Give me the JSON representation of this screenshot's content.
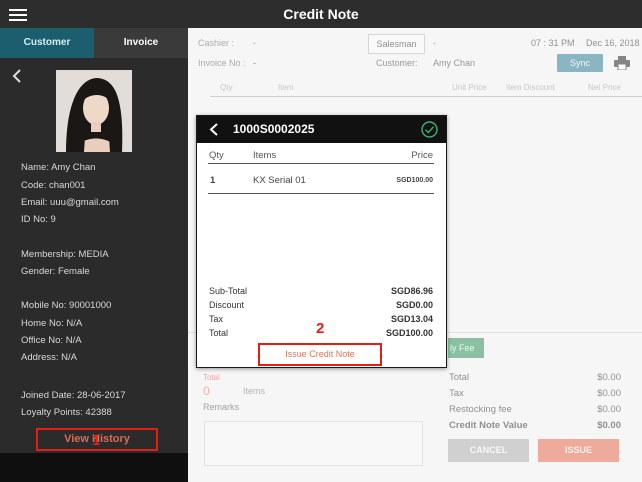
{
  "header": {
    "title": "Credit Note",
    "menu_icon": "hamburger-icon"
  },
  "sidebar": {
    "tabs": [
      {
        "label": "Customer",
        "active": true
      },
      {
        "label": "Invoice",
        "active": false
      }
    ],
    "customer": {
      "name": "Name: Amy Chan",
      "code": "Code: chan001",
      "email": "Email: uuu@gmail.com",
      "id_no": "ID No: 9",
      "membership": "Membership: MEDIA",
      "gender": "Gender: Female",
      "mobile": "Mobile No: 90001000",
      "home": "Home No: N/A",
      "office": "Office No: N/A",
      "address": "Address: N/A",
      "joined": "Joined Date: 28-06-2017",
      "loyalty": "Loyalty Points: 42388"
    },
    "view_history_label": "View History"
  },
  "annotations": {
    "one": "1",
    "two": "2"
  },
  "main": {
    "cashier_label": "Cashier :",
    "cashier_value": "-",
    "invoice_label": "Invoice No :",
    "invoice_value": "-",
    "salesman_label": "Salesman",
    "salesman_value": "-",
    "time": "07 : 31 PM",
    "date": "Dec 16, 2018",
    "customer_label": "Customer:",
    "customer_value": "Amy Chan",
    "sync_label": "Sync",
    "columns": [
      "Qty",
      "Item",
      "Unit Price",
      "Item Discount",
      "Net Price"
    ],
    "fee_chip": "ly Fee",
    "total_label": "Total",
    "total_items": "0",
    "items_label": "Items",
    "remarks_label": "Remarks",
    "summary": [
      {
        "label": "Total",
        "value": "$0.00"
      },
      {
        "label": "Tax",
        "value": "$0.00"
      },
      {
        "label": "Restocking fee",
        "value": "$0.00"
      },
      {
        "label": "Credit Note Value",
        "value": "$0.00"
      }
    ],
    "cancel_label": "CANCEL",
    "issue_label": "ISSUE"
  },
  "modal": {
    "title": "1000S0002025",
    "columns": {
      "qty": "Qty",
      "items": "Items",
      "price": "Price"
    },
    "rows": [
      {
        "qty": "1",
        "item": "KX Serial 01",
        "price": "SGD100.00"
      }
    ],
    "summary": [
      {
        "label": "Sub-Total",
        "value": "SGD86.96"
      },
      {
        "label": "Discount",
        "value": "SGD0.00"
      },
      {
        "label": "Tax",
        "value": "SGD13.04"
      },
      {
        "label": "Total",
        "value": "SGD100.00"
      }
    ],
    "issue_button_label": "Issue Credit Note"
  },
  "colors": {
    "accent": "#1c5d6e",
    "sync": "#2b7a94",
    "issue": "#e06449",
    "annotation": "#e21e15",
    "check": "#3cb371"
  }
}
